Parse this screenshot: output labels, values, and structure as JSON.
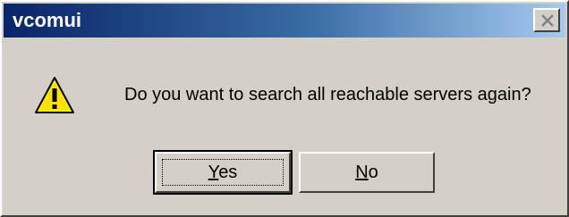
{
  "window": {
    "title": "vcomui"
  },
  "dialog": {
    "message": "Do you want to search all reachable servers again?",
    "icon": "warning-icon"
  },
  "buttons": {
    "yes": {
      "accel": "Y",
      "rest": "es"
    },
    "no": {
      "accel": "N",
      "rest": "o"
    }
  },
  "colors": {
    "titlebar_start": "#0a246a",
    "titlebar_end": "#a6caf0",
    "face": "#d4d0c8"
  }
}
